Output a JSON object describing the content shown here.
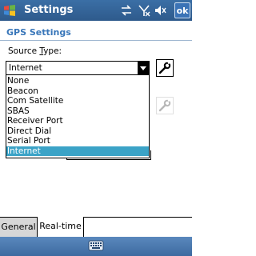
{
  "titlebar": {
    "title": "Settings",
    "ok_label": "ok",
    "icons": [
      "windows-logo-icon",
      "sync-icon",
      "signal-off-icon",
      "volume-mute-icon"
    ]
  },
  "page": {
    "header": "GPS Settings",
    "source_label_prefix": "Source ",
    "source_label_mnemonic": "T",
    "source_label_suffix": "ype:"
  },
  "source_combo": {
    "selected": "Internet",
    "options": [
      "None",
      "Beacon",
      "Com Satellite",
      "SBAS",
      "Receiver Port",
      "Direct Dial",
      "Serial Port",
      "Internet"
    ],
    "selected_index": 7
  },
  "tabs": [
    {
      "label": "General"
    },
    {
      "label": "Real-time"
    }
  ],
  "colors": {
    "title_bar": "#2e5a8c",
    "header_text": "#3876b9",
    "selection": "#3ba3c7"
  }
}
